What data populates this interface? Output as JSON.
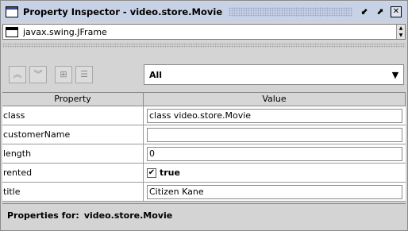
{
  "window": {
    "title": "Property Inspector - video.store.Movie",
    "buttons": {
      "restore": "⬋",
      "maximize": "⬈",
      "close": "✕"
    }
  },
  "selector": {
    "value": "javax.swing.JFrame",
    "spin_up": "▲",
    "spin_down": "▼"
  },
  "toolbar": {
    "move_up": "︽",
    "move_down": "︾",
    "new_property": "⊞",
    "list_view": "☰"
  },
  "filter": {
    "value": "All",
    "arrow": "▼"
  },
  "table": {
    "headers": [
      "Property",
      "Value"
    ],
    "rows": [
      {
        "name": "class",
        "value": "class video.store.Movie"
      },
      {
        "name": "customerName",
        "value": ""
      },
      {
        "name": "length",
        "value": "0"
      },
      {
        "name": "rented",
        "value": "true",
        "checked": true
      },
      {
        "name": "title",
        "value": "Citizen Kane"
      }
    ],
    "check_mark": "✔"
  },
  "footer": {
    "label": "Properties for:",
    "class": "video.store.Movie"
  },
  "colors": {
    "titlebar": "#c8d2e6",
    "panel": "#d4d4d4"
  }
}
